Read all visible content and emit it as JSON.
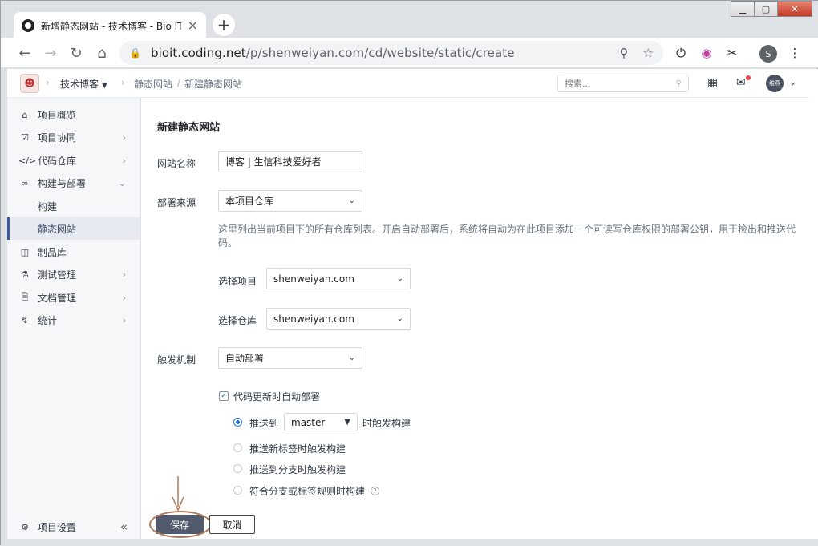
{
  "browser": {
    "tab_title": "新增静态网站 - 技术博客 - Bio IT",
    "tab_close": "×",
    "new_tab": "+",
    "win_min": "▁",
    "win_max": "▢",
    "win_close": "✕",
    "url_host": "bioit.coding.net",
    "url_path": "/p/shenweiyan.com/cd/website/static/create",
    "profile_initial": "S"
  },
  "header": {
    "project": "技术博客",
    "breadcrumb_section": "静态网站",
    "breadcrumb_page": "新建静态网站",
    "search_placeholder": "搜索...",
    "avatar_text": "维燕"
  },
  "sidebar": {
    "items": [
      {
        "label": "项目概览",
        "icon": "home-icon"
      },
      {
        "label": "项目协同",
        "icon": "checkbox-icon"
      },
      {
        "label": "代码仓库",
        "icon": "code-icon"
      },
      {
        "label": "构建与部署",
        "icon": "infinity-icon"
      },
      {
        "label": "构建",
        "icon": ""
      },
      {
        "label": "静态网站",
        "icon": ""
      },
      {
        "label": "制品库",
        "icon": "artifact-icon"
      },
      {
        "label": "测试管理",
        "icon": "flask-icon"
      },
      {
        "label": "文档管理",
        "icon": "doc-icon"
      },
      {
        "label": "统计",
        "icon": "chart-icon"
      }
    ],
    "settings_label": "项目设置",
    "collapse_glyph": "«"
  },
  "form": {
    "title": "新建静态网站",
    "site_name_label": "网站名称",
    "site_name_value": "博客 | 生信科技爱好者",
    "source_label": "部署来源",
    "source_value": "本项目仓库",
    "help_text": "这里列出当前项目下的所有仓库列表。开启自动部署后，系统将自动为在此项目添加一个可读写仓库权限的部署公钥，用于检出和推送代码。",
    "project_label": "选择项目",
    "project_value": "shenweiyan.com",
    "repo_label": "选择仓库",
    "repo_value": "shenweiyan.com",
    "trigger_label": "触发机制",
    "trigger_value": "自动部署",
    "auto_deploy_label": "代码更新时自动部署",
    "push_to_label": "推送到",
    "branch_value": "master",
    "push_suffix": "时触发构建",
    "radio_tag": "推送新标签时触发构建",
    "radio_branch": "推送到分支时触发构建",
    "radio_rule": "符合分支或标签规则时构建",
    "save_label": "保存",
    "cancel_label": "取消"
  },
  "colors": {
    "accent": "#1f6fe0",
    "save_button": "#525b6e",
    "annotation": "#b07a5a"
  }
}
